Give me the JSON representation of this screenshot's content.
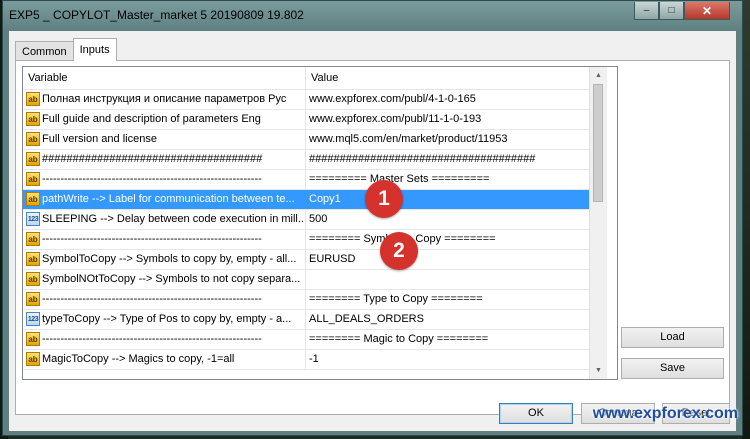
{
  "window": {
    "title": "EXP5 _ COPYLOT_Master_market 5 20190809 19.802"
  },
  "tabs": [
    {
      "label": "Common"
    },
    {
      "label": "Inputs"
    }
  ],
  "grid": {
    "header": {
      "variable": "Variable",
      "value": "Value"
    },
    "rows": [
      {
        "icon": "ab",
        "variable": "Полная инструкция и описание параметров Рус",
        "value": "www.expforex.com/publ/4-1-0-165"
      },
      {
        "icon": "ab",
        "variable": "Full guide and description of parameters Eng",
        "value": "www.expforex.com/publ/11-1-0-193"
      },
      {
        "icon": "ab",
        "variable": "Full version and license",
        "value": "www.mql5.com/en/market/product/11953"
      },
      {
        "icon": "ab",
        "variable": "####################################",
        "value": "#####################################"
      },
      {
        "icon": "ab",
        "variable": "------------------------------------------------------------",
        "value": "========= Master Sets ========="
      },
      {
        "icon": "ab",
        "variable": "pathWrite --> Label for communication between te...",
        "value": "Copy1",
        "selected": true
      },
      {
        "icon": "123",
        "variable": "SLEEPING --> Delay between code execution in mill...",
        "value": "500"
      },
      {
        "icon": "ab",
        "variable": "------------------------------------------------------------",
        "value": "======== Symbol to Copy ========"
      },
      {
        "icon": "ab",
        "variable": "SymbolToCopy --> Symbols to copy by, empty - all...",
        "value": "EURUSD"
      },
      {
        "icon": "ab",
        "variable": "SymbolNOtToCopy --> Symbols to not copy separa...",
        "value": ""
      },
      {
        "icon": "ab",
        "variable": "------------------------------------------------------------",
        "value": "======== Type to Copy ========"
      },
      {
        "icon": "123",
        "variable": "typeToCopy --> Type of Pos to copy by, empty - a...",
        "value": "ALL_DEALS_ORDERS"
      },
      {
        "icon": "ab",
        "variable": "------------------------------------------------------------",
        "value": "======== Magic to Copy ========"
      },
      {
        "icon": "ab",
        "variable": "MagicToCopy --> Magics to copy, -1=all",
        "value": "-1"
      }
    ]
  },
  "buttons": {
    "load": "Load",
    "save": "Save",
    "ok": "OK",
    "cancel": "Отмена",
    "reset": "Reset"
  },
  "callouts": [
    {
      "number": "1"
    },
    {
      "number": "2"
    }
  ],
  "watermark": "www.expforex.com",
  "colors": {
    "selection": "#3399ff",
    "callout": "#d5312d",
    "titlebar": "#6b8c8d"
  }
}
